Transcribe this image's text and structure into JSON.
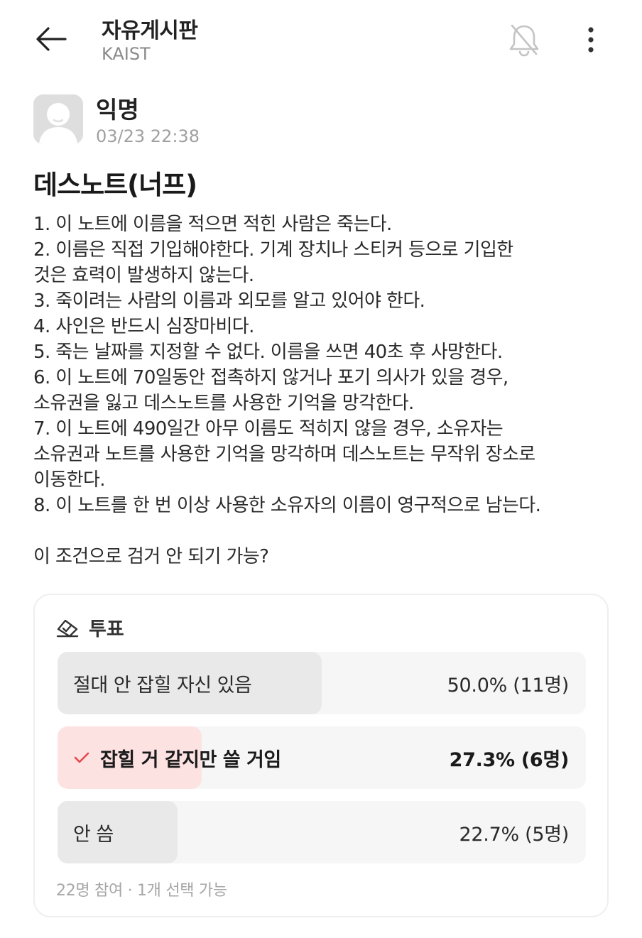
{
  "header": {
    "board_title": "자유게시판",
    "board_subtitle": "KAIST",
    "back_icon": "arrow-left-icon",
    "notification_icon": "bell-off-icon",
    "more_icon": "more-vertical-icon"
  },
  "post": {
    "author": "익명",
    "timestamp": "03/23 22:38",
    "title": "데스노트(너프)",
    "body_lines": [
      "1. 이 노트에 이름을 적으면 적힌 사람은 죽는다.",
      "2. 이름은 직접 기입해야한다. 기계 장치나 스티커 등으로 기입한",
      "것은 효력이 발생하지 않는다.",
      "3. 죽이려는 사람의 이름과 외모를 알고 있어야 한다.",
      "4. 사인은 반드시 심장마비다.",
      "5. 죽는 날짜를 지정할 수 없다. 이름을 쓰면 40초 후 사망한다.",
      "6. 이 노트에 70일동안 접촉하지 않거나 포기 의사가 있을 경우,",
      "소유권을 잃고 데스노트를 사용한 기억을 망각한다.",
      "7. 이 노트에 490일간 아무 이름도 적히지 않을 경우, 소유자는",
      "소유권과 노트를 사용한 기억을 망각하며 데스노트는 무작위 장소로",
      "이동한다.",
      "8. 이 노트를 한 번 이상 사용한 소유자의 이름이 영구적으로 남는다."
    ],
    "question": "이 조건으로 검거 안 되기 가능?"
  },
  "poll": {
    "label": "투표",
    "icon": "vote-box-icon",
    "options": [
      {
        "text": "절대 안 잡힐 자신 있음",
        "result": "50.0% (11명)",
        "fraction": 0.5,
        "selected": false
      },
      {
        "text": "잡힐 거 같지만 쓸 거임",
        "result": "27.3% (6명)",
        "fraction": 0.273,
        "selected": true
      },
      {
        "text": "안 씀",
        "result": "22.7% (5명)",
        "fraction": 0.227,
        "selected": false
      }
    ],
    "footer": "22명 참여 · 1개 선택 가능"
  },
  "colors": {
    "fill_default": "#e9e9e9",
    "fill_selected": "#fde2e2",
    "check": "#e5484d"
  }
}
